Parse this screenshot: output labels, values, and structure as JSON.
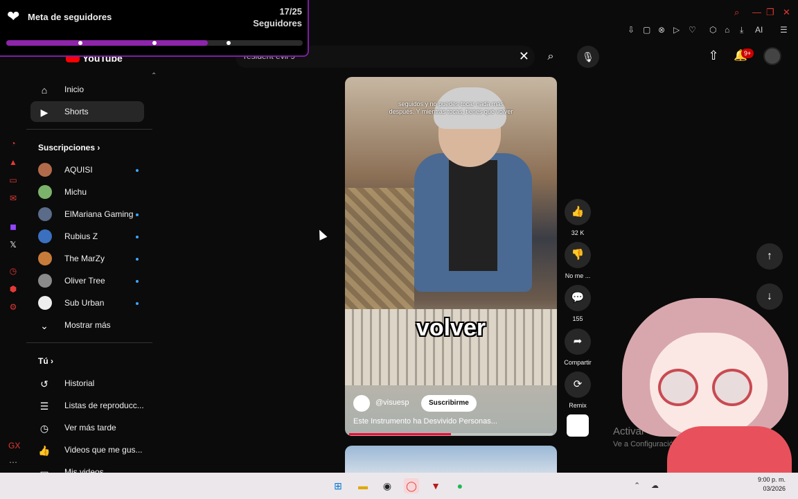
{
  "overlay": {
    "title": "Meta de seguidores",
    "count": "17/25",
    "unit": "Seguidores",
    "progress": 0.68
  },
  "browser": {
    "extensions": [
      "pin-icon",
      "square-icon",
      "shield-icon",
      "play-icon",
      "heart-icon",
      "puzzle-icon",
      "lock-icon",
      "download-icon",
      "ai-icon",
      "menu-icon"
    ],
    "ai_label": "AI"
  },
  "youtube": {
    "logo": "YouTube",
    "search_query": "resident evil 9",
    "notifications_badge": "9+"
  },
  "sidebar": {
    "main": [
      {
        "label": "Inicio",
        "icon": "home-icon"
      },
      {
        "label": "Shorts",
        "icon": "shorts-icon",
        "active": true
      }
    ],
    "subs_title": "Suscripciones",
    "subs": [
      {
        "label": "AQUISI",
        "color": "#b26b4a"
      },
      {
        "label": "Michu",
        "color": "#7cb36a"
      },
      {
        "label": "ElMariana Gaming",
        "color": "#5b6b8a"
      },
      {
        "label": "Rubius Z",
        "color": "#3b6fbf"
      },
      {
        "label": "The MarZy",
        "color": "#c77b3a"
      },
      {
        "label": "Oliver Tree",
        "color": "#8a8a8a"
      },
      {
        "label": "Sub Urban",
        "color": "#eeeeee"
      }
    ],
    "show_more": "Mostrar más",
    "you_title": "Tú",
    "you": [
      {
        "label": "Historial",
        "icon": "history-icon"
      },
      {
        "label": "Listas de reproducc...",
        "icon": "playlist-icon"
      },
      {
        "label": "Ver más tarde",
        "icon": "clock-icon"
      },
      {
        "label": "Videos que me gus...",
        "icon": "like-icon"
      },
      {
        "label": "Mis videos",
        "icon": "video-icon"
      }
    ]
  },
  "short": {
    "top_caption": "seguidos y no puedes tocar nada más después. Y mientras tocas, tienes que volver",
    "big_caption": "volver",
    "handle": "@visuesp",
    "subscribe": "Suscribirme",
    "title": "Este Instrumento ha Desvivido Personas...",
    "progress": 0.5
  },
  "actions": [
    {
      "name": "like",
      "label": "32 K",
      "icon": "👍"
    },
    {
      "name": "dislike",
      "label": "No me ...",
      "icon": "👎"
    },
    {
      "name": "comments",
      "label": "155",
      "icon": "💬"
    },
    {
      "name": "share",
      "label": "Compartir",
      "icon": "➦"
    },
    {
      "name": "remix",
      "label": "Remix",
      "icon": "⟳"
    }
  ],
  "watermark": {
    "line1": "Activar Windows",
    "line2": "Ve a Configuración para activar Windows."
  },
  "clock": {
    "time": "9:00 p. m.",
    "date": "03/2026"
  }
}
